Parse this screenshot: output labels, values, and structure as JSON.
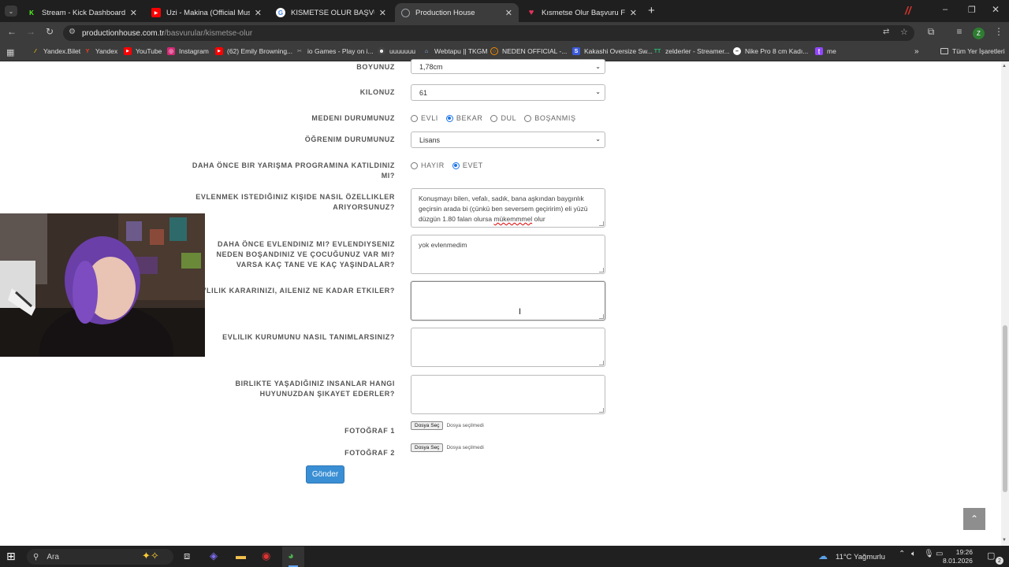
{
  "browser": {
    "tabs": [
      {
        "title": "Stream - Kick Dashboard",
        "active": false,
        "icon": "kick-icon",
        "color": "#53fc18"
      },
      {
        "title": "Uzi - Makina (Official Music Vid",
        "active": false,
        "icon": "youtube-icon",
        "color": "#ff0000"
      },
      {
        "title": "KISMETSE OLUR BAŞVURU - Go",
        "active": false,
        "icon": "google-forms-icon",
        "color": "#ffffff"
      },
      {
        "title": "Production House",
        "active": true,
        "icon": "globe-icon",
        "color": "#9aa0a6"
      },
      {
        "title": "Kısmetse Olur Başvuru Formu -",
        "active": false,
        "icon": "heart-icon",
        "color": "#e8325c"
      }
    ],
    "new_tab": "+",
    "url_host": "productionhouse.com.tr",
    "url_path": "/basvurular/kismetse-olur",
    "profile_initial": "Z",
    "bookmarks": [
      {
        "label": "Yandex.Bilet",
        "icon": "yandex-bilet-icon",
        "color": "#ffcc00"
      },
      {
        "label": "Yandex",
        "icon": "yandex-icon",
        "color": "#fc3f1d"
      },
      {
        "label": "YouTube",
        "icon": "youtube-icon",
        "color": "#ff0000"
      },
      {
        "label": "Instagram",
        "icon": "instagram-icon",
        "color": "#d62976"
      },
      {
        "label": "(62) Emily Browning...",
        "icon": "youtube-icon",
        "color": "#ff0000"
      },
      {
        "label": "io Games - Play on i...",
        "icon": "io-games-icon",
        "color": "#888888"
      },
      {
        "label": "uuuuuuu",
        "icon": "discord-icon",
        "color": "#5865f2"
      },
      {
        "label": "Webtapu || TKGM",
        "icon": "tkgm-icon",
        "color": "#1a6fb5"
      },
      {
        "label": "NEDEN OFFICIAL -...",
        "icon": "neden-icon",
        "color": "#f28b00"
      },
      {
        "label": "Kakashi Oversize Sw...",
        "icon": "k-icon",
        "color": "#3b5bdb"
      },
      {
        "label": "zelderler - Streamer...",
        "icon": "streamer-icon",
        "color": "#2bb673"
      },
      {
        "label": "Nike Pro 8 cm Kadı...",
        "icon": "nike-icon",
        "color": "#ffffff"
      },
      {
        "label": "me",
        "icon": "twitch-icon",
        "color": "#9146ff"
      }
    ],
    "all_bookmarks": "Tüm Yer İşaretleri"
  },
  "form": {
    "height_label": "BOYUNUZ",
    "height_value": "1,78cm",
    "weight_label": "KILONUZ",
    "weight_value": "61",
    "marital_label": "MEDENI DURUMUNUZ",
    "marital_options": [
      {
        "label": "EVLI",
        "selected": false
      },
      {
        "label": "BEKAR",
        "selected": true
      },
      {
        "label": "DUL",
        "selected": false
      },
      {
        "label": "BOŞANMIŞ",
        "selected": false
      }
    ],
    "education_label": "ÖĞRENIM DURUMUNUZ",
    "education_value": "Lisans",
    "contest_label_1": "DAHA ÖNCE BIR YARIŞMA PROGRAMINA KATILDINIZ",
    "contest_label_2": "MI?",
    "contest_options": [
      {
        "label": "HAYIR",
        "selected": false
      },
      {
        "label": "EVET",
        "selected": true
      }
    ],
    "partner_label_1": "EVLENMEK ISTEDIĞINIZ KIŞIDE NASIL ÖZELLIKLER",
    "partner_label_2": "ARIYORSUNUZ?",
    "partner_value_1": "Konuşmayı bilen, vefalı, sadık, bana aşkından baygınlık",
    "partner_value_2": "geçirsin arada bi (çünkü ben seversem geçiririm) eli yüzü",
    "partner_value_3a": "düzgün 1.80 falan olursa ",
    "partner_value_3b": "mükemmmel",
    "partner_value_3c": " olur",
    "married_label_1": "DAHA ÖNCE EVLENDINIZ MI? EVLENDIYSENIZ",
    "married_label_2": "NEDEN BOŞANDINIZ VE ÇOCUĞUNUZ VAR MI?",
    "married_label_3": "VARSA KAÇ TANE VE KAÇ YAŞINDALAR?",
    "married_value": "yok evlenmedim",
    "family_label": "EVLILIK KARARINIZI, AILENIZ NE KADAR ETKILER?",
    "family_value": "",
    "define_label": "EVLILIK KURUMUNU NASIL TANIMLARSINIZ?",
    "define_value": "",
    "complain_label_1": "BIRLIKTE YAŞADIĞINIZ INSANLAR HANGI",
    "complain_label_2": "HUYUNUZDAN ŞIKAYET EDERLER?",
    "complain_value": "",
    "photo1_label": "FOTOĞRAF 1",
    "photo2_label": "FOTOĞRAF 2",
    "file_button": "Dosya Seç",
    "file_status": "Dosya seçilmedi",
    "submit": "Gönder"
  },
  "taskbar": {
    "search_placeholder": "Ara",
    "weather": "11°C  Yağmurlu",
    "time": "19:26",
    "date": "8.01.2026",
    "notifications": "2"
  }
}
